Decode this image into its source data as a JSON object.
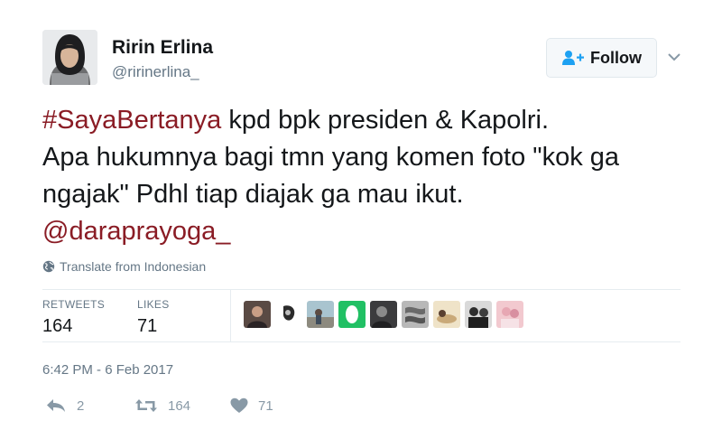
{
  "user": {
    "name": "Ririn Erlina",
    "handle": "@ririnerlina_"
  },
  "follow": {
    "label": "Follow"
  },
  "tweet": {
    "hashtag": "#SayaBertanya",
    "line1_rest": " kpd bpk presiden & Kapolri.",
    "line2": "Apa hukumnya bagi tmn yang komen foto \"kok ga ngajak\" Pdhl tiap diajak ga mau ikut.",
    "mention": "@daraprayoga_"
  },
  "translate": {
    "label": "Translate from Indonesian"
  },
  "stats": {
    "retweets_label": "RETWEETS",
    "retweets_value": "164",
    "likes_label": "LIKES",
    "likes_value": "71"
  },
  "timestamp": "6:42 PM - 6 Feb 2017",
  "actions": {
    "reply_count": "2",
    "retweet_count": "164",
    "like_count": "71"
  },
  "colors": {
    "link": "#8a1c25",
    "muted": "#657786",
    "follow_icon": "#1da1f2"
  }
}
